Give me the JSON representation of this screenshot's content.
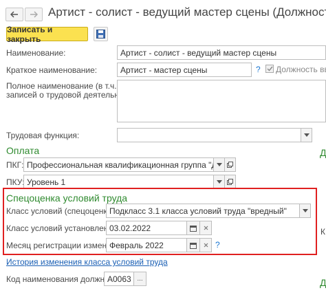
{
  "window": {
    "title": "Артист - солист - ведущий мастер сцены (Должность)"
  },
  "toolbar": {
    "save_close_label": "Записать и закрыть"
  },
  "form": {
    "name_label": "Наименование:",
    "name_value": "Артист - солист - ведущий мастер сцены",
    "short_name_label": "Краткое наименование:",
    "short_name_value": "Артист - мастер сцены",
    "position_checkbox_label": "Должность введ",
    "full_name_label_1": "Полное наименование (в т.ч. для",
    "full_name_label_2": "записей о трудовой деятельности):",
    "labor_function_label": "Трудовая функция:",
    "labor_function_value": "",
    "pay_section": "Оплата",
    "pkg_label": "ПКГ:",
    "pkg_value": "Профессиональная квалификационная группа \"Должности р",
    "pku_label": "ПКУ:",
    "pku_value": "Уровень 1",
    "conditions_section": "Спецоценка условий труда",
    "class_label": "Класс условий (спецоценка):",
    "class_value": "Подкласс 3.1 класса условий труда \"вредный\"",
    "class_set_label": "Класс условий установлен с:",
    "class_set_value": "03.02.2022",
    "month_label": "Месяц регистрации изменений:",
    "month_value": "Февраль 2022",
    "history_link": "История изменения класса условий труда",
    "code_label": "Код наименования должности:",
    "code_value": "A0063",
    "more_glyph": "...",
    "help_glyph": "?"
  },
  "right_edge": {
    "d1": "Д",
    "d2": "К",
    "d3": "Д"
  }
}
